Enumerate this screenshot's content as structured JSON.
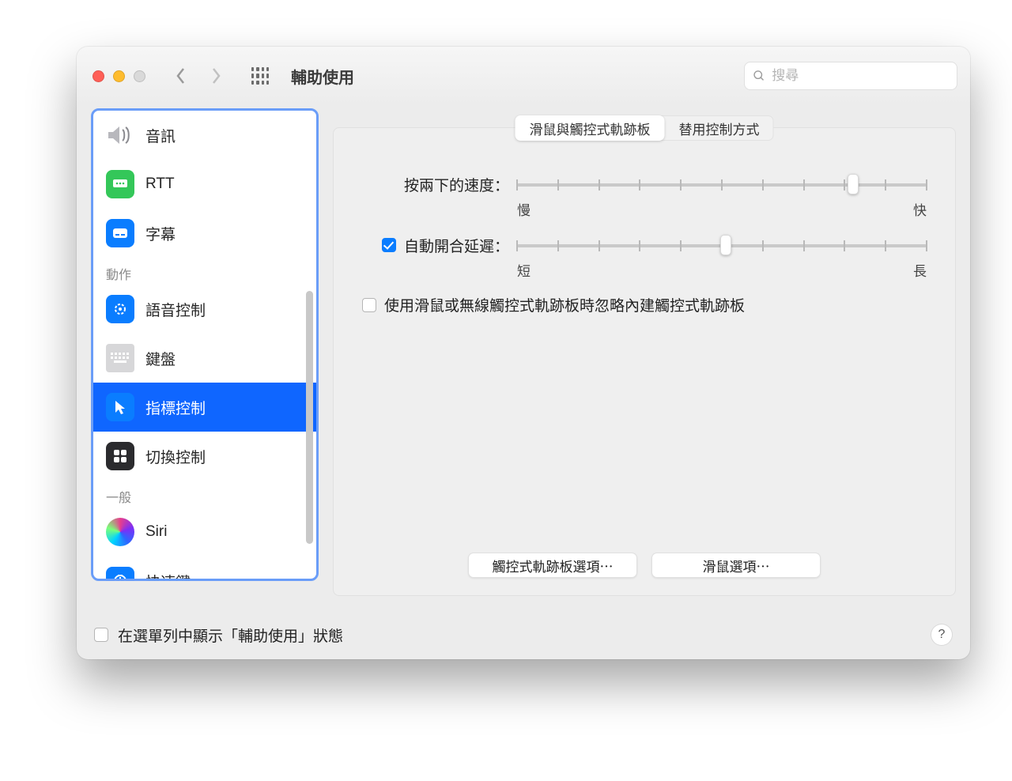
{
  "toolbar": {
    "title": "輔助使用",
    "search_placeholder": "搜尋"
  },
  "sidebar": {
    "items": [
      {
        "label": "音訊",
        "icon": "speaker"
      },
      {
        "label": "RTT",
        "icon": "rtt"
      },
      {
        "label": "字幕",
        "icon": "captions"
      }
    ],
    "section_motor": "動作",
    "motor_items": [
      {
        "label": "語音控制",
        "icon": "voice"
      },
      {
        "label": "鍵盤",
        "icon": "keyboard"
      },
      {
        "label": "指標控制",
        "icon": "pointer",
        "selected": true
      },
      {
        "label": "切換控制",
        "icon": "switch"
      }
    ],
    "section_general": "一般",
    "general_items": [
      {
        "label": "Siri",
        "icon": "siri"
      },
      {
        "label": "快速鍵",
        "icon": "shortcut"
      }
    ]
  },
  "tabs": {
    "t1": "滑鼠與觸控式軌跡板",
    "t2": "替用控制方式"
  },
  "sliders": {
    "double_click_label": "按兩下的速度：",
    "double_click_min": "慢",
    "double_click_max": "快",
    "double_click_value": 82,
    "spring_label": "自動開合延遲：",
    "spring_min": "短",
    "spring_max": "長",
    "spring_value": 51,
    "spring_checked": true
  },
  "ignore_trackpad": {
    "label": "使用滑鼠或無線觸控式軌跡板時忽略內建觸控式軌跡板",
    "checked": false
  },
  "buttons": {
    "trackpad_options": "觸控式軌跡板選項⋯",
    "mouse_options": "滑鼠選項⋯"
  },
  "footer": {
    "show_status_label": "在選單列中顯示「輔助使用」狀態",
    "show_status_checked": false,
    "help": "?"
  }
}
